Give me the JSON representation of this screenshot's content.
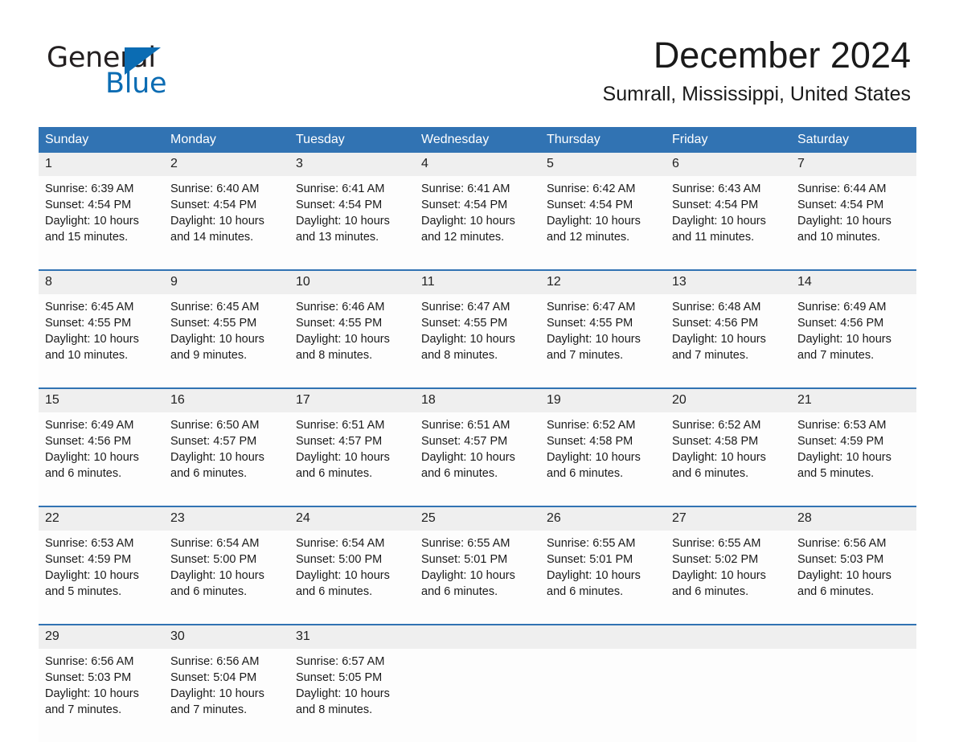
{
  "brand": {
    "name_part1": "General",
    "name_part2": "Blue",
    "triangle_color": "#0b6cb3",
    "text_color": "#231f20"
  },
  "header": {
    "month_title": "December 2024",
    "location": "Sumrall, Mississippi, United States"
  },
  "theme": {
    "header_blue": "#3173b3",
    "daynum_band": "#efefef",
    "page_background": "#ffffff",
    "text": "#1a1a1a"
  },
  "calendar": {
    "weekday_headers": [
      "Sunday",
      "Monday",
      "Tuesday",
      "Wednesday",
      "Thursday",
      "Friday",
      "Saturday"
    ],
    "weeks": [
      {
        "days": [
          {
            "date": "1",
            "sunrise": "Sunrise: 6:39 AM",
            "sunset": "Sunset: 4:54 PM",
            "daylight_line1": "Daylight: 10 hours",
            "daylight_line2": "and 15 minutes."
          },
          {
            "date": "2",
            "sunrise": "Sunrise: 6:40 AM",
            "sunset": "Sunset: 4:54 PM",
            "daylight_line1": "Daylight: 10 hours",
            "daylight_line2": "and 14 minutes."
          },
          {
            "date": "3",
            "sunrise": "Sunrise: 6:41 AM",
            "sunset": "Sunset: 4:54 PM",
            "daylight_line1": "Daylight: 10 hours",
            "daylight_line2": "and 13 minutes."
          },
          {
            "date": "4",
            "sunrise": "Sunrise: 6:41 AM",
            "sunset": "Sunset: 4:54 PM",
            "daylight_line1": "Daylight: 10 hours",
            "daylight_line2": "and 12 minutes."
          },
          {
            "date": "5",
            "sunrise": "Sunrise: 6:42 AM",
            "sunset": "Sunset: 4:54 PM",
            "daylight_line1": "Daylight: 10 hours",
            "daylight_line2": "and 12 minutes."
          },
          {
            "date": "6",
            "sunrise": "Sunrise: 6:43 AM",
            "sunset": "Sunset: 4:54 PM",
            "daylight_line1": "Daylight: 10 hours",
            "daylight_line2": "and 11 minutes."
          },
          {
            "date": "7",
            "sunrise": "Sunrise: 6:44 AM",
            "sunset": "Sunset: 4:54 PM",
            "daylight_line1": "Daylight: 10 hours",
            "daylight_line2": "and 10 minutes."
          }
        ]
      },
      {
        "days": [
          {
            "date": "8",
            "sunrise": "Sunrise: 6:45 AM",
            "sunset": "Sunset: 4:55 PM",
            "daylight_line1": "Daylight: 10 hours",
            "daylight_line2": "and 10 minutes."
          },
          {
            "date": "9",
            "sunrise": "Sunrise: 6:45 AM",
            "sunset": "Sunset: 4:55 PM",
            "daylight_line1": "Daylight: 10 hours",
            "daylight_line2": "and 9 minutes."
          },
          {
            "date": "10",
            "sunrise": "Sunrise: 6:46 AM",
            "sunset": "Sunset: 4:55 PM",
            "daylight_line1": "Daylight: 10 hours",
            "daylight_line2": "and 8 minutes."
          },
          {
            "date": "11",
            "sunrise": "Sunrise: 6:47 AM",
            "sunset": "Sunset: 4:55 PM",
            "daylight_line1": "Daylight: 10 hours",
            "daylight_line2": "and 8 minutes."
          },
          {
            "date": "12",
            "sunrise": "Sunrise: 6:47 AM",
            "sunset": "Sunset: 4:55 PM",
            "daylight_line1": "Daylight: 10 hours",
            "daylight_line2": "and 7 minutes."
          },
          {
            "date": "13",
            "sunrise": "Sunrise: 6:48 AM",
            "sunset": "Sunset: 4:56 PM",
            "daylight_line1": "Daylight: 10 hours",
            "daylight_line2": "and 7 minutes."
          },
          {
            "date": "14",
            "sunrise": "Sunrise: 6:49 AM",
            "sunset": "Sunset: 4:56 PM",
            "daylight_line1": "Daylight: 10 hours",
            "daylight_line2": "and 7 minutes."
          }
        ]
      },
      {
        "days": [
          {
            "date": "15",
            "sunrise": "Sunrise: 6:49 AM",
            "sunset": "Sunset: 4:56 PM",
            "daylight_line1": "Daylight: 10 hours",
            "daylight_line2": "and 6 minutes."
          },
          {
            "date": "16",
            "sunrise": "Sunrise: 6:50 AM",
            "sunset": "Sunset: 4:57 PM",
            "daylight_line1": "Daylight: 10 hours",
            "daylight_line2": "and 6 minutes."
          },
          {
            "date": "17",
            "sunrise": "Sunrise: 6:51 AM",
            "sunset": "Sunset: 4:57 PM",
            "daylight_line1": "Daylight: 10 hours",
            "daylight_line2": "and 6 minutes."
          },
          {
            "date": "18",
            "sunrise": "Sunrise: 6:51 AM",
            "sunset": "Sunset: 4:57 PM",
            "daylight_line1": "Daylight: 10 hours",
            "daylight_line2": "and 6 minutes."
          },
          {
            "date": "19",
            "sunrise": "Sunrise: 6:52 AM",
            "sunset": "Sunset: 4:58 PM",
            "daylight_line1": "Daylight: 10 hours",
            "daylight_line2": "and 6 minutes."
          },
          {
            "date": "20",
            "sunrise": "Sunrise: 6:52 AM",
            "sunset": "Sunset: 4:58 PM",
            "daylight_line1": "Daylight: 10 hours",
            "daylight_line2": "and 6 minutes."
          },
          {
            "date": "21",
            "sunrise": "Sunrise: 6:53 AM",
            "sunset": "Sunset: 4:59 PM",
            "daylight_line1": "Daylight: 10 hours",
            "daylight_line2": "and 5 minutes."
          }
        ]
      },
      {
        "days": [
          {
            "date": "22",
            "sunrise": "Sunrise: 6:53 AM",
            "sunset": "Sunset: 4:59 PM",
            "daylight_line1": "Daylight: 10 hours",
            "daylight_line2": "and 5 minutes."
          },
          {
            "date": "23",
            "sunrise": "Sunrise: 6:54 AM",
            "sunset": "Sunset: 5:00 PM",
            "daylight_line1": "Daylight: 10 hours",
            "daylight_line2": "and 6 minutes."
          },
          {
            "date": "24",
            "sunrise": "Sunrise: 6:54 AM",
            "sunset": "Sunset: 5:00 PM",
            "daylight_line1": "Daylight: 10 hours",
            "daylight_line2": "and 6 minutes."
          },
          {
            "date": "25",
            "sunrise": "Sunrise: 6:55 AM",
            "sunset": "Sunset: 5:01 PM",
            "daylight_line1": "Daylight: 10 hours",
            "daylight_line2": "and 6 minutes."
          },
          {
            "date": "26",
            "sunrise": "Sunrise: 6:55 AM",
            "sunset": "Sunset: 5:01 PM",
            "daylight_line1": "Daylight: 10 hours",
            "daylight_line2": "and 6 minutes."
          },
          {
            "date": "27",
            "sunrise": "Sunrise: 6:55 AM",
            "sunset": "Sunset: 5:02 PM",
            "daylight_line1": "Daylight: 10 hours",
            "daylight_line2": "and 6 minutes."
          },
          {
            "date": "28",
            "sunrise": "Sunrise: 6:56 AM",
            "sunset": "Sunset: 5:03 PM",
            "daylight_line1": "Daylight: 10 hours",
            "daylight_line2": "and 6 minutes."
          }
        ]
      },
      {
        "days": [
          {
            "date": "29",
            "sunrise": "Sunrise: 6:56 AM",
            "sunset": "Sunset: 5:03 PM",
            "daylight_line1": "Daylight: 10 hours",
            "daylight_line2": "and 7 minutes."
          },
          {
            "date": "30",
            "sunrise": "Sunrise: 6:56 AM",
            "sunset": "Sunset: 5:04 PM",
            "daylight_line1": "Daylight: 10 hours",
            "daylight_line2": "and 7 minutes."
          },
          {
            "date": "31",
            "sunrise": "Sunrise: 6:57 AM",
            "sunset": "Sunset: 5:05 PM",
            "daylight_line1": "Daylight: 10 hours",
            "daylight_line2": "and 8 minutes."
          },
          {
            "date": "",
            "sunrise": "",
            "sunset": "",
            "daylight_line1": "",
            "daylight_line2": ""
          },
          {
            "date": "",
            "sunrise": "",
            "sunset": "",
            "daylight_line1": "",
            "daylight_line2": ""
          },
          {
            "date": "",
            "sunrise": "",
            "sunset": "",
            "daylight_line1": "",
            "daylight_line2": ""
          },
          {
            "date": "",
            "sunrise": "",
            "sunset": "",
            "daylight_line1": "",
            "daylight_line2": ""
          }
        ]
      }
    ]
  }
}
